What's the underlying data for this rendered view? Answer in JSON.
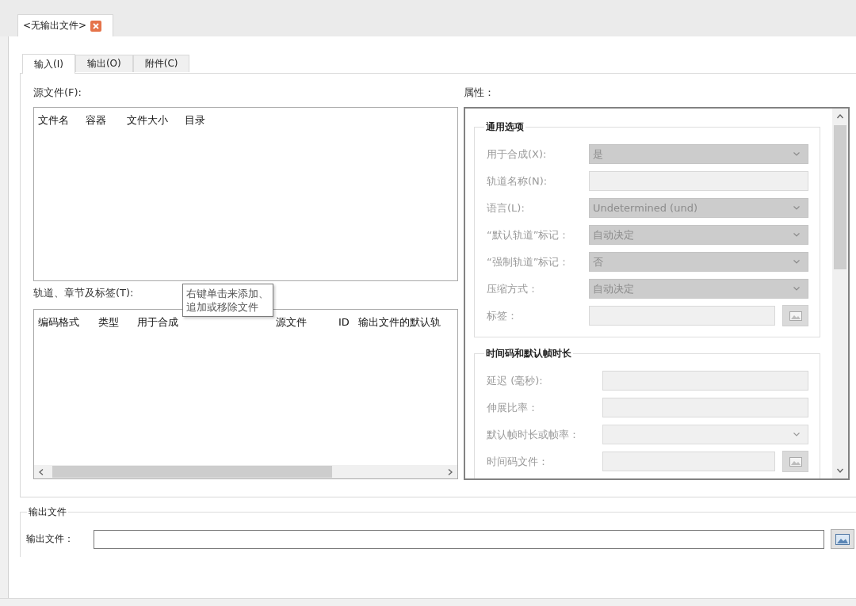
{
  "document_tab": {
    "label": "<无输出文件>",
    "selected": true
  },
  "tabs": [
    {
      "label": "输入(I)",
      "selected": true
    },
    {
      "label": "输出(O)",
      "selected": false
    },
    {
      "label": "附件(C)",
      "selected": false
    }
  ],
  "source_files": {
    "label": "源文件(F):",
    "columns": [
      "文件名",
      "容器",
      "文件大小",
      "目录"
    ]
  },
  "tracks": {
    "label": "轨道、章节及标签(T):",
    "columns": [
      "编码格式",
      "类型",
      "用于合成",
      "源文件",
      "ID",
      "输出文件的默认轨"
    ],
    "tooltip": "右键单击来添加、追加或移除文件"
  },
  "properties": {
    "label": "属性：",
    "groups": [
      {
        "title": "通用选项",
        "fields": [
          {
            "kind": "dropdown",
            "label": "用于合成(X):",
            "value": "是",
            "disabled": true
          },
          {
            "kind": "text",
            "label": "轨道名称(N):",
            "disabled": true
          },
          {
            "kind": "dropdown",
            "label": "语言(L):",
            "value": "Undetermined (und)",
            "disabled": true
          },
          {
            "kind": "dropdown",
            "label": "“默认轨道”标记：",
            "value": "自动决定",
            "disabled": true
          },
          {
            "kind": "dropdown",
            "label": "“强制轨道”标记：",
            "value": "否",
            "disabled": true
          },
          {
            "kind": "dropdown",
            "label": "压缩方式：",
            "value": "自动决定",
            "disabled": true
          },
          {
            "kind": "file",
            "label": "标签：",
            "disabled": true
          }
        ]
      },
      {
        "title": "时间码和默认帧时长",
        "fields": [
          {
            "kind": "text",
            "label": "延迟 (毫秒):",
            "disabled": true
          },
          {
            "kind": "text",
            "label": "伸展比率：",
            "disabled": true
          },
          {
            "kind": "combobox",
            "label": "默认帧时长或帧率：",
            "disabled": true
          },
          {
            "kind": "file",
            "label": "时间码文件：",
            "disabled": true
          }
        ]
      }
    ]
  },
  "output": {
    "title": "输出文件",
    "label": "输出文件："
  }
}
